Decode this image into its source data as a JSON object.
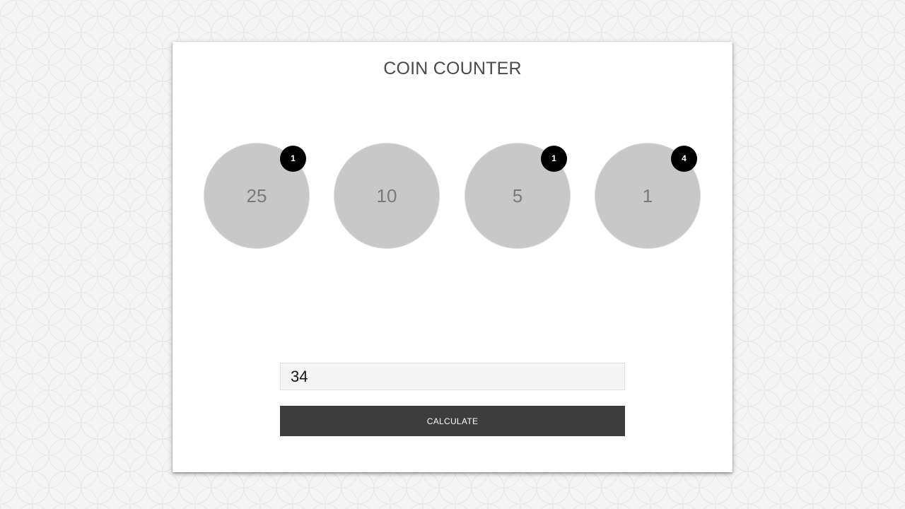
{
  "app": {
    "title": "COIN COUNTER"
  },
  "coins": [
    {
      "value": "25",
      "count": "1"
    },
    {
      "value": "10",
      "count": ""
    },
    {
      "value": "5",
      "count": "1"
    },
    {
      "value": "1",
      "count": "4"
    }
  ],
  "form": {
    "amount_value": "34",
    "calculate_label": "CALCULATE"
  },
  "colors": {
    "coin": "#c8c8c8",
    "badge": "#000000",
    "button": "#3d3d3d",
    "background": "#f4f4f4"
  }
}
